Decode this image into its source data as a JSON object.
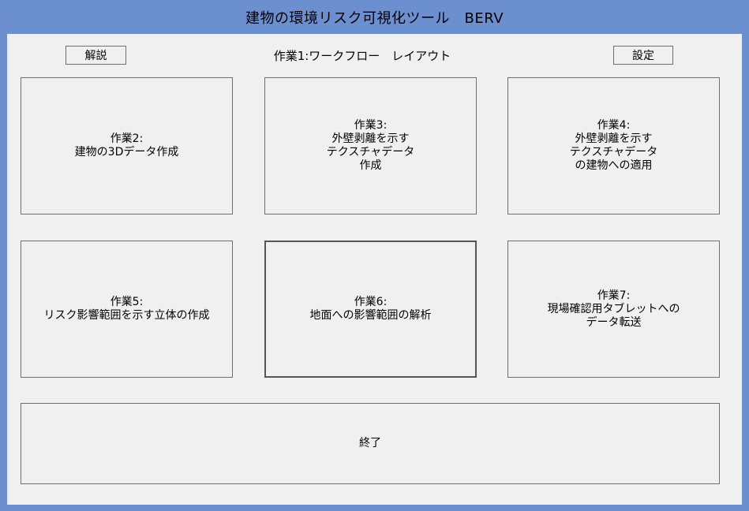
{
  "window": {
    "title": "建物の環境リスク可視化ツール　BERV"
  },
  "toolbar": {
    "help_label": "解説",
    "heading": "作業1:ワークフロー　レイアウト",
    "settings_label": "設定"
  },
  "tasks": [
    {
      "label": "作業2:\n建物の3Dデータ作成"
    },
    {
      "label": "作業3:\n外壁剥離を示す\nテクスチャデータ\n作成"
    },
    {
      "label": "作業4:\n外壁剥離を示す\nテクスチャデータ\nの建物への適用"
    },
    {
      "label": "作業5:\nリスク影響範囲を示す立体の作成"
    },
    {
      "label": "作業6:\n地面への影響範囲の解析"
    },
    {
      "label": "作業7:\n現場確認用タブレットへの\nデータ転送"
    }
  ],
  "footer": {
    "exit_label": "終了"
  }
}
